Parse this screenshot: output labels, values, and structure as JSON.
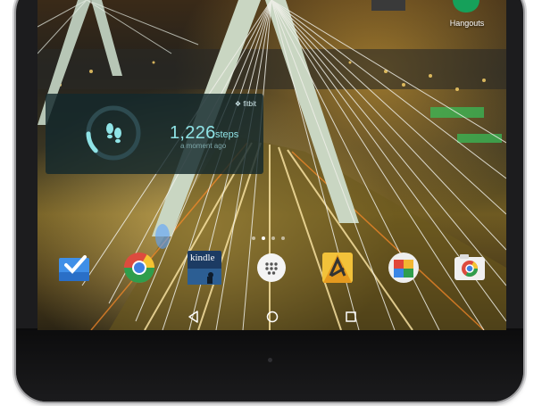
{
  "home": {
    "hangouts": {
      "label": "Hangouts",
      "icon": "hangouts-icon"
    },
    "fitbit_widget": {
      "brand": "❖ fitbit",
      "steps": "1,226",
      "unit": "steps",
      "subtitle": "a moment ago",
      "progress_fraction": 0.12,
      "icon": "footsteps-icon",
      "accent_color": "#8fe3e6"
    },
    "page_indicator": {
      "count": 4,
      "current": 2
    },
    "dock": [
      {
        "name": "inbox",
        "icon": "inbox-icon"
      },
      {
        "name": "chrome",
        "icon": "chrome-icon"
      },
      {
        "name": "kindle",
        "icon": "kindle-icon",
        "label": "kindle"
      },
      {
        "name": "app-drawer",
        "icon": "app-drawer-icon"
      },
      {
        "name": "yelp",
        "icon": "yelp-icon"
      },
      {
        "name": "photos",
        "icon": "photos-icon"
      },
      {
        "name": "camera",
        "icon": "camera-icon"
      }
    ],
    "nav": [
      {
        "name": "back",
        "icon": "back-icon"
      },
      {
        "name": "home",
        "icon": "home-icon"
      },
      {
        "name": "recents",
        "icon": "recents-icon"
      }
    ]
  }
}
